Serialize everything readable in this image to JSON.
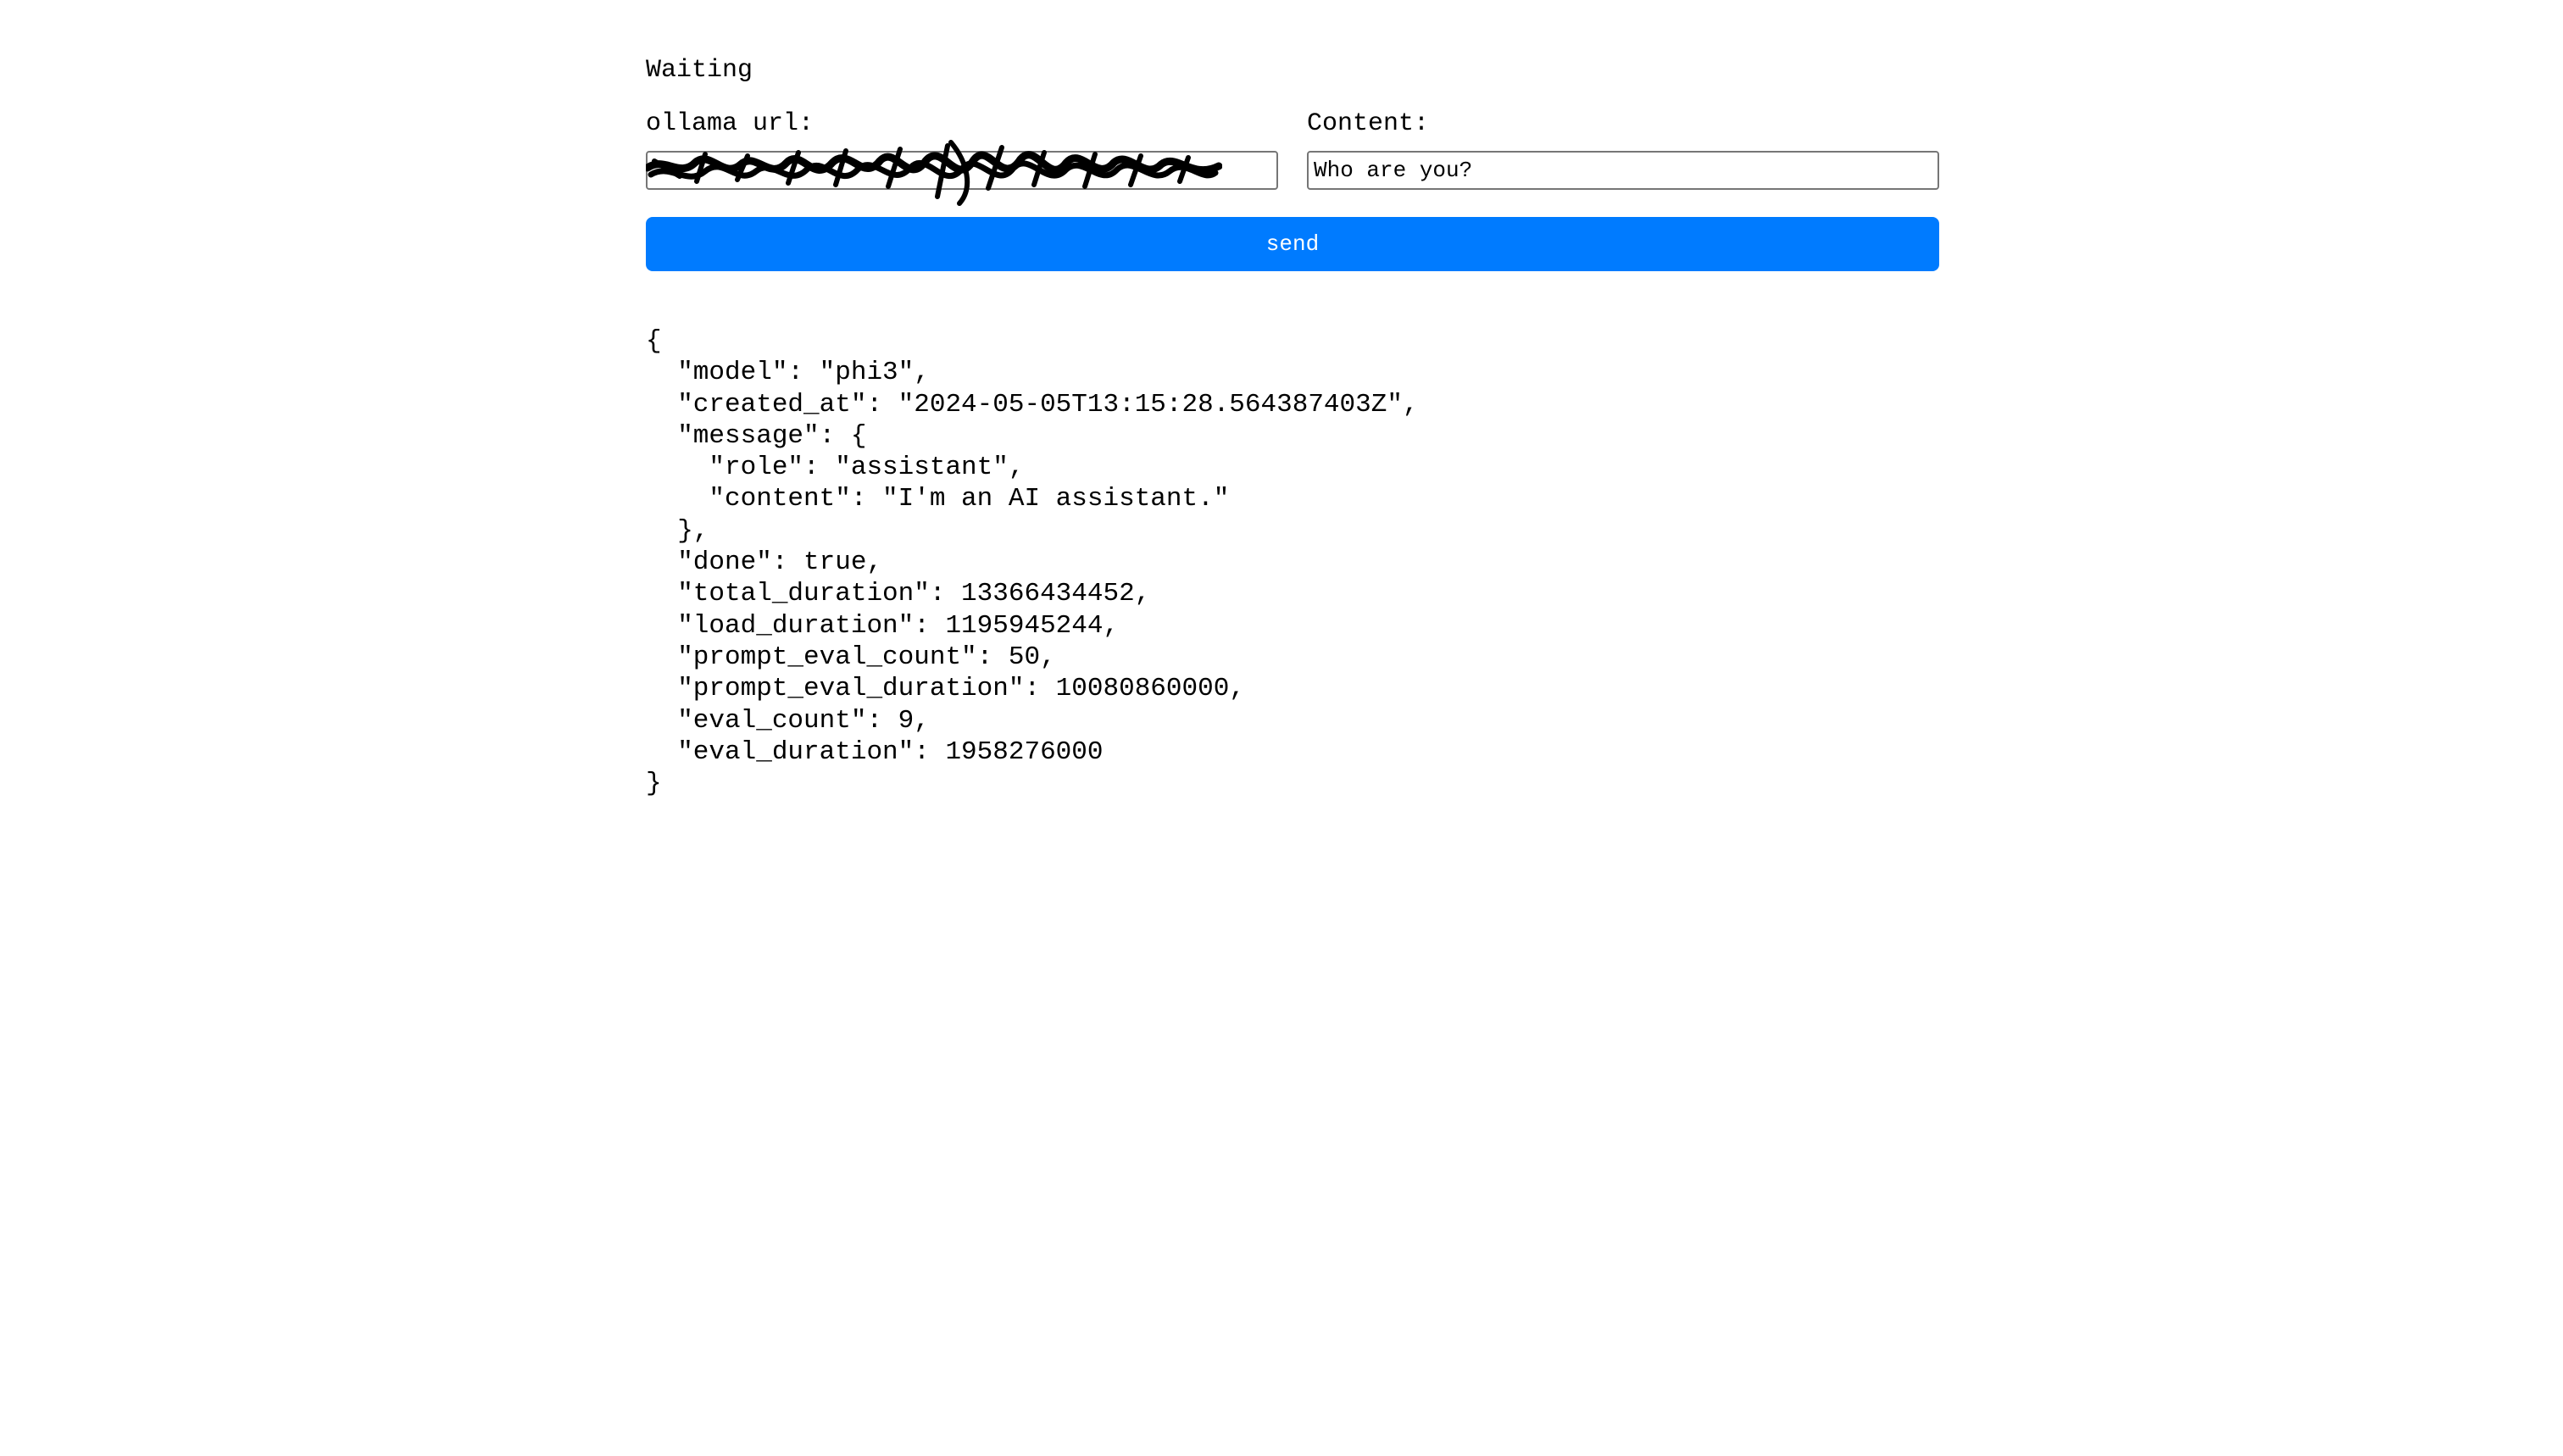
{
  "status": "Waiting",
  "url_field": {
    "label": "ollama url:",
    "value": ""
  },
  "content_field": {
    "label": "Content:",
    "value": "Who are you?"
  },
  "send_button": {
    "label": "send",
    "color": "#007bff"
  },
  "response_lines": [
    "{",
    "  \"model\": \"phi3\",",
    "  \"created_at\": \"2024-05-05T13:15:28.564387403Z\",",
    "  \"message\": {",
    "    \"role\": \"assistant\",",
    "    \"content\": \"I'm an AI assistant.\"",
    "  },",
    "  \"done\": true,",
    "  \"total_duration\": 13366434452,",
    "  \"load_duration\": 1195945244,",
    "  \"prompt_eval_count\": 50,",
    "  \"prompt_eval_duration\": 10080860000,",
    "  \"eval_count\": 9,",
    "  \"eval_duration\": 1958276000",
    "}"
  ]
}
